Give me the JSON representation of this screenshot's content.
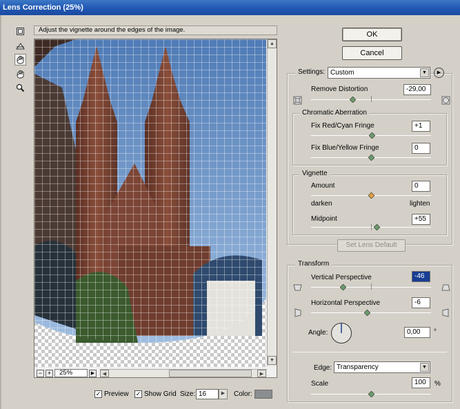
{
  "window": {
    "title": "Lens Correction (25%)"
  },
  "hint": "Adjust the vignette around the edges of the image.",
  "tools": [
    {
      "name": "remove-distortion-tool-icon"
    },
    {
      "name": "straighten-tool-icon"
    },
    {
      "name": "move-grid-tool-icon"
    },
    {
      "name": "hand-tool-icon"
    },
    {
      "name": "zoom-tool-icon"
    }
  ],
  "buttons": {
    "ok": "OK",
    "cancel": "Cancel",
    "set_lens_default": "Set Lens Default"
  },
  "settings": {
    "label": "Settings:",
    "value": "Custom"
  },
  "remove_distortion": {
    "label": "Remove Distortion",
    "value": "-29,00",
    "level": 0.35
  },
  "chromatic": {
    "title": "Chromatic Aberration",
    "red_cyan": {
      "label": "Fix Red/Cyan Fringe",
      "value": "+1",
      "level": 0.51
    },
    "blue_yellow": {
      "label": "Fix Blue/Yellow Fringe",
      "value": "0",
      "level": 0.5
    }
  },
  "vignette": {
    "title": "Vignette",
    "amount": {
      "label": "Amount",
      "value": "0",
      "level": 0.5,
      "left": "darken",
      "right": "lighten"
    },
    "midpoint": {
      "label": "Midpoint",
      "value": "+55",
      "level": 0.55
    }
  },
  "transform": {
    "title": "Transform",
    "vertical": {
      "label": "Vertical Perspective",
      "value": "-46",
      "level": 0.27
    },
    "horizontal": {
      "label": "Horizontal Perspective",
      "value": "-6",
      "level": 0.47
    },
    "angle": {
      "label": "Angle:",
      "value": "0,00",
      "unit": "°"
    },
    "edge": {
      "label": "Edge:",
      "value": "Transparency"
    },
    "scale": {
      "label": "Scale",
      "value": "100",
      "unit": "%",
      "level": 0.5
    }
  },
  "bottom": {
    "zoom": "25%",
    "preview": "Preview",
    "show_grid": "Show Grid",
    "size_label": "Size:",
    "size": "16",
    "color_label": "Color:",
    "grid_color": "#8a8e90"
  },
  "colors": {
    "title_bar": "#2157b3",
    "sky": "#5d86bd",
    "brick": "#7a4634"
  }
}
